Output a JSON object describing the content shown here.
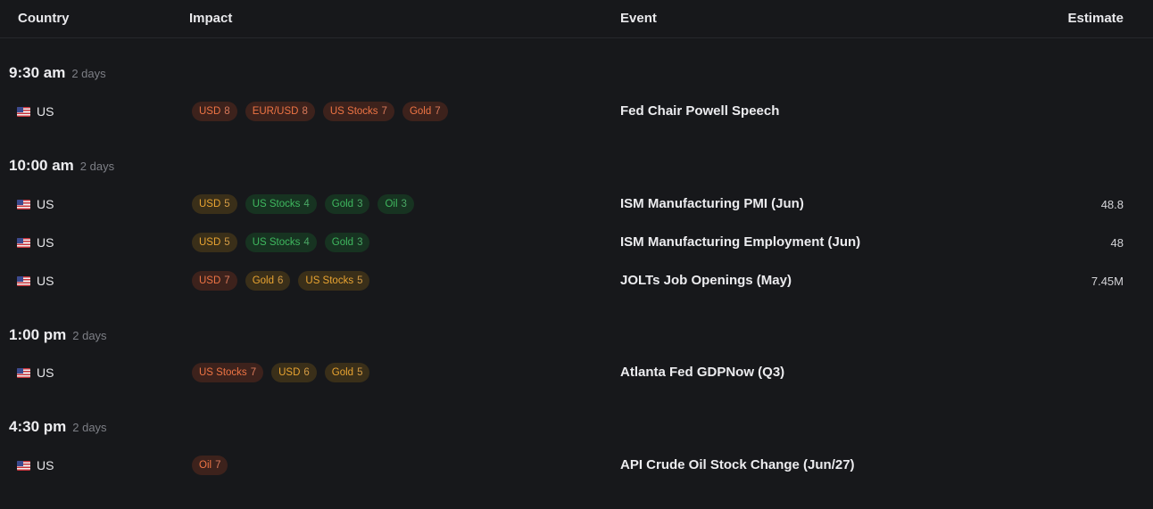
{
  "header": {
    "country": "Country",
    "impact": "Impact",
    "event": "Event",
    "estimate": "Estimate"
  },
  "colors": {
    "background": "#17181b",
    "tag_red_bg": "#3d221c",
    "tag_red_text": "#ee7444",
    "tag_amber_bg": "#3a2f19",
    "tag_amber_text": "#e9a431",
    "tag_green_bg": "#173321",
    "tag_green_text": "#3fb85f"
  },
  "groups": [
    {
      "time": "9:30 am",
      "relative": "2 days",
      "rows": [
        {
          "flag_icon": "us-flag-icon",
          "country": "US",
          "tags": [
            {
              "label": "USD",
              "value": "8",
              "level": "red"
            },
            {
              "label": "EUR/USD",
              "value": "8",
              "level": "red"
            },
            {
              "label": "US Stocks",
              "value": "7",
              "level": "red"
            },
            {
              "label": "Gold",
              "value": "7",
              "level": "red"
            }
          ],
          "event": "Fed Chair Powell Speech",
          "estimate": ""
        }
      ]
    },
    {
      "time": "10:00 am",
      "relative": "2 days",
      "rows": [
        {
          "flag_icon": "us-flag-icon",
          "country": "US",
          "tags": [
            {
              "label": "USD",
              "value": "5",
              "level": "amber"
            },
            {
              "label": "US Stocks",
              "value": "4",
              "level": "green"
            },
            {
              "label": "Gold",
              "value": "3",
              "level": "green"
            },
            {
              "label": "Oil",
              "value": "3",
              "level": "green"
            }
          ],
          "event": "ISM Manufacturing PMI (Jun)",
          "estimate": "48.8"
        },
        {
          "flag_icon": "us-flag-icon",
          "country": "US",
          "tags": [
            {
              "label": "USD",
              "value": "5",
              "level": "amber"
            },
            {
              "label": "US Stocks",
              "value": "4",
              "level": "green"
            },
            {
              "label": "Gold",
              "value": "3",
              "level": "green"
            }
          ],
          "event": "ISM Manufacturing Employment (Jun)",
          "estimate": "48"
        },
        {
          "flag_icon": "us-flag-icon",
          "country": "US",
          "tags": [
            {
              "label": "USD",
              "value": "7",
              "level": "red"
            },
            {
              "label": "Gold",
              "value": "6",
              "level": "amber"
            },
            {
              "label": "US Stocks",
              "value": "5",
              "level": "amber"
            }
          ],
          "event": "JOLTs Job Openings (May)",
          "estimate": "7.45M"
        }
      ]
    },
    {
      "time": "1:00 pm",
      "relative": "2 days",
      "rows": [
        {
          "flag_icon": "us-flag-icon",
          "country": "US",
          "tags": [
            {
              "label": "US Stocks",
              "value": "7",
              "level": "red"
            },
            {
              "label": "USD",
              "value": "6",
              "level": "amber"
            },
            {
              "label": "Gold",
              "value": "5",
              "level": "amber"
            }
          ],
          "event": "Atlanta Fed GDPNow (Q3)",
          "estimate": ""
        }
      ]
    },
    {
      "time": "4:30 pm",
      "relative": "2 days",
      "rows": [
        {
          "flag_icon": "us-flag-icon",
          "country": "US",
          "tags": [
            {
              "label": "Oil",
              "value": "7",
              "level": "red"
            }
          ],
          "event": "API Crude Oil Stock Change (Jun/27)",
          "estimate": ""
        }
      ]
    }
  ]
}
